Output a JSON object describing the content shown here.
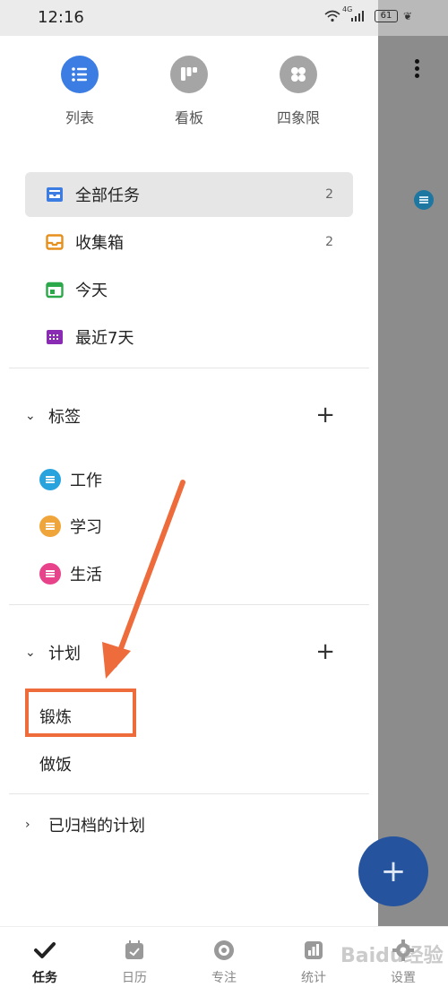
{
  "status_bar": {
    "time": "12:16",
    "network": "4G",
    "battery": "61"
  },
  "views": [
    {
      "label": "列表",
      "icon": "list-icon",
      "active": true
    },
    {
      "label": "看板",
      "icon": "kanban-icon",
      "active": false
    },
    {
      "label": "四象限",
      "icon": "quadrant-icon",
      "active": false
    }
  ],
  "smart_lists": [
    {
      "label": "全部任务",
      "count": "2",
      "icon": "inbox-stack-icon",
      "active": true
    },
    {
      "label": "收集箱",
      "count": "2",
      "icon": "inbox-tray-icon",
      "active": false
    },
    {
      "label": "今天",
      "count": "",
      "icon": "calendar-today-icon",
      "active": false
    },
    {
      "label": "最近7天",
      "count": "",
      "icon": "calendar-week-icon",
      "active": false
    }
  ],
  "tags_section": {
    "title": "标签",
    "items": [
      {
        "label": "工作",
        "color": "#29a3de"
      },
      {
        "label": "学习",
        "color": "#f0a53a"
      },
      {
        "label": "生活",
        "color": "#e8428a"
      }
    ]
  },
  "plans_section": {
    "title": "计划",
    "items": [
      {
        "label": "锻炼"
      },
      {
        "label": "做饭"
      }
    ]
  },
  "archived": {
    "label": "已归档的计划"
  },
  "bottom_nav": [
    {
      "label": "任务",
      "icon": "check-icon",
      "active": true
    },
    {
      "label": "日历",
      "icon": "calendar-icon",
      "active": false
    },
    {
      "label": "专注",
      "icon": "focus-icon",
      "active": false
    },
    {
      "label": "统计",
      "icon": "stats-icon",
      "active": false
    },
    {
      "label": "设置",
      "icon": "gear-icon",
      "active": false
    }
  ],
  "colors": {
    "accent": "#3b7de3",
    "annotation": "#ee6b3c",
    "overlay": "#8c8c8c",
    "fab": "#25539e"
  },
  "watermark": "Baidu经验"
}
